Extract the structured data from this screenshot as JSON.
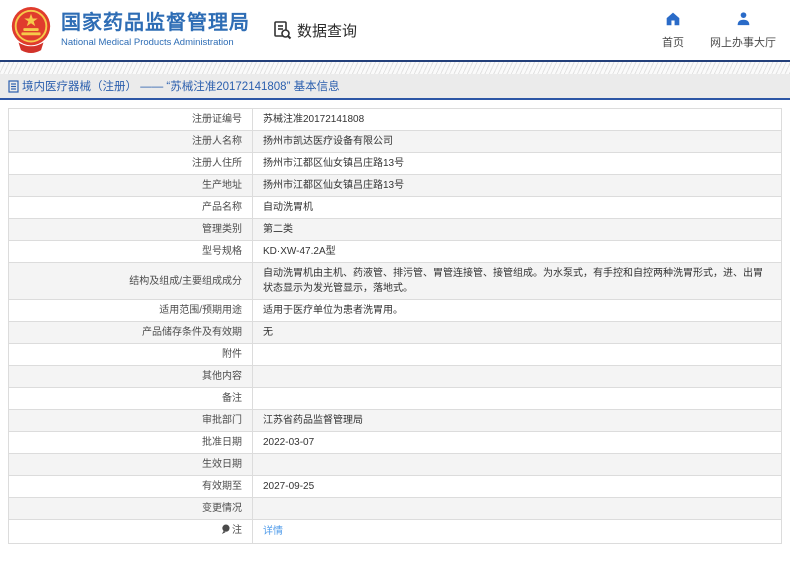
{
  "header": {
    "agency_name_cn": "国家药品监督管理局",
    "agency_name_en": "National Medical Products Administration",
    "section_title": "数据查询",
    "accent_color": "#2e6db5",
    "nav": [
      {
        "label": "首页",
        "icon": "home-icon"
      },
      {
        "label": "网上办事大厅",
        "icon": "user-icon"
      }
    ]
  },
  "breadcrumb": {
    "text": "境内医疗器械（注册） —— “苏械注准20172141808” 基本信息"
  },
  "table": {
    "link_color": "#4f9bea",
    "rows": [
      {
        "label": "注册证编号",
        "value": "苏械注准20172141808"
      },
      {
        "label": "注册人名称",
        "value": "扬州市凯达医疗设备有限公司"
      },
      {
        "label": "注册人住所",
        "value": "扬州市江都区仙女镇吕庄路13号"
      },
      {
        "label": "生产地址",
        "value": "扬州市江都区仙女镇吕庄路13号"
      },
      {
        "label": "产品名称",
        "value": "自动洗胃机"
      },
      {
        "label": "管理类别",
        "value": "第二类"
      },
      {
        "label": "型号规格",
        "value": "KD·XW-47.2A型"
      },
      {
        "label": "结构及组成/主要组成成分",
        "value": "自动洗胃机由主机、药液管、排污管、胃管连接管、接管组成。为水泵式，有手控和自控两种洗胃形式，进、出胃状态显示为发光管显示，落地式。"
      },
      {
        "label": "适用范围/预期用途",
        "value": "适用于医疗单位为患者洗胃用。"
      },
      {
        "label": "产品储存条件及有效期",
        "value": "无"
      },
      {
        "label": "附件",
        "value": ""
      },
      {
        "label": "其他内容",
        "value": ""
      },
      {
        "label": "备注",
        "value": ""
      },
      {
        "label": "审批部门",
        "value": "江苏省药品监督管理局"
      },
      {
        "label": "批准日期",
        "value": "2022-03-07"
      },
      {
        "label": "生效日期",
        "value": ""
      },
      {
        "label": "有效期至",
        "value": "2027-09-25"
      },
      {
        "label": "变更情况",
        "value": ""
      },
      {
        "label": "注",
        "value": "详情"
      }
    ]
  }
}
